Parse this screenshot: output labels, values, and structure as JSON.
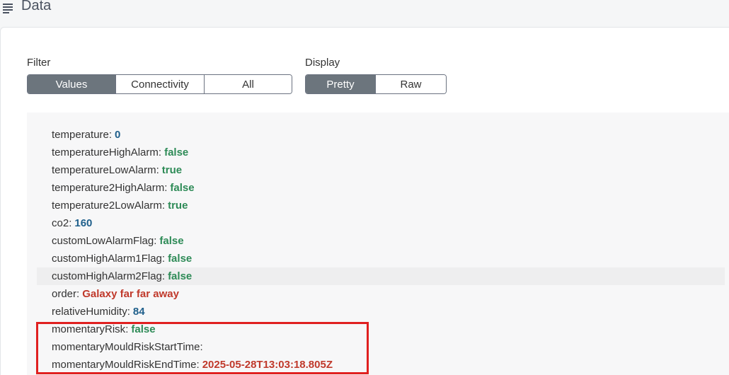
{
  "header": {
    "title": "Data",
    "menu_icon": "hamburger-menu-icon"
  },
  "filter": {
    "label": "Filter",
    "options": [
      "Values",
      "Connectivity",
      "All"
    ],
    "selected": "Values"
  },
  "display": {
    "label": "Display",
    "options": [
      "Pretty",
      "Raw"
    ],
    "selected": "Pretty"
  },
  "data": [
    {
      "key": "temperature",
      "value": "0",
      "type": "number"
    },
    {
      "key": "temperatureHighAlarm",
      "value": "false",
      "type": "boolean"
    },
    {
      "key": "temperatureLowAlarm",
      "value": "true",
      "type": "boolean"
    },
    {
      "key": "temperature2HighAlarm",
      "value": "false",
      "type": "boolean"
    },
    {
      "key": "temperature2LowAlarm",
      "value": "true",
      "type": "boolean"
    },
    {
      "key": "co2",
      "value": "160",
      "type": "number"
    },
    {
      "key": "customLowAlarmFlag",
      "value": "false",
      "type": "boolean"
    },
    {
      "key": "customHighAlarm1Flag",
      "value": "false",
      "type": "boolean"
    },
    {
      "key": "customHighAlarm2Flag",
      "value": "false",
      "type": "boolean"
    },
    {
      "key": "order",
      "value": "Galaxy far far away",
      "type": "string"
    },
    {
      "key": "relativeHumidity",
      "value": "84",
      "type": "number"
    },
    {
      "key": "momentaryRisk",
      "value": "false",
      "type": "boolean"
    },
    {
      "key": "momentaryMouldRiskStartTime",
      "value": "",
      "type": "string"
    },
    {
      "key": "momentaryMouldRiskEndTime",
      "value": "2025-05-28T13:03:18.805Z",
      "type": "string"
    }
  ],
  "colors": {
    "number": "#1f5f8b",
    "boolean": "#2e8b57",
    "string": "#c0392b",
    "active_segment": "#6c757d",
    "highlight": "#e02020"
  }
}
